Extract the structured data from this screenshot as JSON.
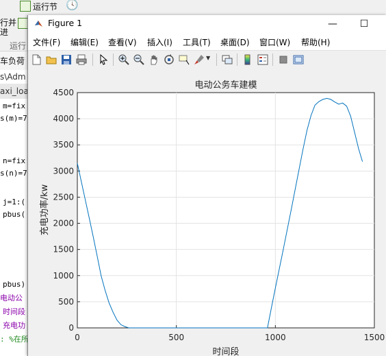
{
  "desktop": {
    "ribbon": {
      "run_section_label": "运行节",
      "run_label": "运行",
      "partial_labels": [
        "行并",
        "进"
      ]
    },
    "path_partial": "s\\Adm",
    "file_tab_partial": "axi_loa",
    "left_partial_label": "车负荷",
    "code_lines": [
      "m=fix",
      "s(m)=7",
      "n=fix",
      "s(n)=7",
      "j=1:(",
      "pbus(",
      "pbus)",
      "电动公",
      "时间段",
      "充电功",
      ": %在所"
    ]
  },
  "figure": {
    "title": "Figure 1",
    "controls": {
      "minimize": "—",
      "maximize": "☐"
    },
    "menu": [
      "文件(F)",
      "编辑(E)",
      "查看(V)",
      "插入(I)",
      "工具(T)",
      "桌面(D)",
      "窗口(W)",
      "帮助(H)"
    ],
    "toolbar_icons": [
      "new-figure-icon",
      "open-file-icon",
      "save-icon",
      "print-icon",
      "pointer-icon",
      "zoom-in-icon",
      "zoom-out-icon",
      "pan-icon",
      "rotate-icon",
      "data-cursor-icon",
      "brush-icon",
      "link-plot-icon",
      "colorbar-icon",
      "legend-icon",
      "hide-tools-icon",
      "show-tools-icon"
    ]
  },
  "chart_data": {
    "type": "line",
    "title": "电动公务车建模",
    "xlabel": "时间段",
    "ylabel": "充电功率/kw",
    "xlim": [
      0,
      1500
    ],
    "ylim": [
      0,
      4500
    ],
    "xticks": [
      0,
      500,
      1000,
      1500
    ],
    "yticks": [
      0,
      500,
      1000,
      1500,
      2000,
      2500,
      3000,
      3500,
      4000,
      4500
    ],
    "grid": true,
    "color": "#0072bd",
    "x": [
      0,
      20,
      40,
      60,
      80,
      100,
      120,
      140,
      160,
      180,
      200,
      220,
      240,
      260,
      280,
      300,
      400,
      500,
      600,
      700,
      800,
      900,
      960,
      980,
      1000,
      1020,
      1040,
      1060,
      1080,
      1100,
      1120,
      1140,
      1160,
      1180,
      1200,
      1220,
      1240,
      1260,
      1280,
      1300,
      1320,
      1340,
      1360,
      1380,
      1400,
      1420,
      1440
    ],
    "y": [
      3150,
      2800,
      2450,
      2100,
      1750,
      1380,
      1000,
      720,
      480,
      300,
      150,
      60,
      25,
      0,
      0,
      0,
      0,
      0,
      0,
      0,
      0,
      0,
      0,
      380,
      760,
      1130,
      1500,
      1880,
      2260,
      2650,
      3040,
      3420,
      3780,
      4060,
      4260,
      4330,
      4370,
      4390,
      4370,
      4320,
      4280,
      4300,
      4240,
      4050,
      3740,
      3430,
      3180
    ]
  }
}
